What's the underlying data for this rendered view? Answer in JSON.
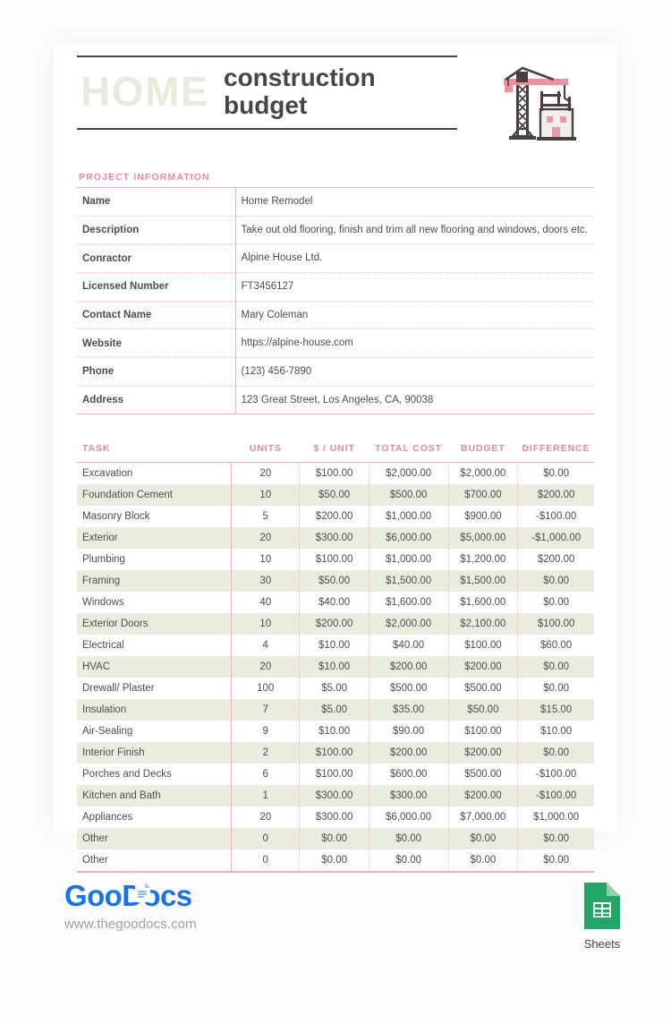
{
  "document": {
    "title_home": "HOME",
    "title_rest_line1": "construction",
    "title_rest_line2": "budget",
    "crane_icon": "construction-crane-icon"
  },
  "project_information": {
    "section_label": "PROJECT INFORMATION",
    "rows": [
      {
        "label": "Name",
        "value": "Home Remodel"
      },
      {
        "label": "Description",
        "value": "Take out old flooring, finish and trim all new flooring and windows, doors etc."
      },
      {
        "label": "Conractor",
        "value": "Alpine House Ltd."
      },
      {
        "label": "Licensed Number",
        "value": "FT3456127"
      },
      {
        "label": "Contact Name",
        "value": "Mary Coleman"
      },
      {
        "label": "Website",
        "value": "https://alpine-house.com"
      },
      {
        "label": "Phone",
        "value": "(123) 456-7890"
      },
      {
        "label": "Address",
        "value": "123 Great Street, Los Angeles, CA, 90038"
      }
    ]
  },
  "budget_table": {
    "headers": [
      "TASK",
      "UNITS",
      "$ / UNIT",
      "TOTAL COST",
      "BUDGET",
      "DIFFERENCE"
    ],
    "rows": [
      {
        "task": "Excavation",
        "units": "20",
        "unit_cost": "$100.00",
        "total_cost": "$2,000.00",
        "budget": "$2,000.00",
        "difference": "$0.00",
        "negative": false
      },
      {
        "task": "Foundation Cement",
        "units": "10",
        "unit_cost": "$50.00",
        "total_cost": "$500.00",
        "budget": "$700.00",
        "difference": "$200.00",
        "negative": false
      },
      {
        "task": "Masonry Block",
        "units": "5",
        "unit_cost": "$200.00",
        "total_cost": "$1,000.00",
        "budget": "$900.00",
        "difference": "-$100.00",
        "negative": true
      },
      {
        "task": "Exterior",
        "units": "20",
        "unit_cost": "$300.00",
        "total_cost": "$6,000.00",
        "budget": "$5,000.00",
        "difference": "-$1,000.00",
        "negative": true
      },
      {
        "task": "Plumbing",
        "units": "10",
        "unit_cost": "$100.00",
        "total_cost": "$1,000.00",
        "budget": "$1,200.00",
        "difference": "$200.00",
        "negative": false
      },
      {
        "task": "Framing",
        "units": "30",
        "unit_cost": "$50.00",
        "total_cost": "$1,500.00",
        "budget": "$1,500.00",
        "difference": "$0.00",
        "negative": false
      },
      {
        "task": "Windows",
        "units": "40",
        "unit_cost": "$40.00",
        "total_cost": "$1,600.00",
        "budget": "$1,600.00",
        "difference": "$0.00",
        "negative": false
      },
      {
        "task": "Exterior Doors",
        "units": "10",
        "unit_cost": "$200.00",
        "total_cost": "$2,000.00",
        "budget": "$2,100.00",
        "difference": "$100.00",
        "negative": false
      },
      {
        "task": "Electrical",
        "units": "4",
        "unit_cost": "$10.00",
        "total_cost": "$40.00",
        "budget": "$100.00",
        "difference": "$60.00",
        "negative": false
      },
      {
        "task": "HVAC",
        "units": "20",
        "unit_cost": "$10.00",
        "total_cost": "$200.00",
        "budget": "$200.00",
        "difference": "$0.00",
        "negative": false
      },
      {
        "task": "Drewall/ Plaster",
        "units": "100",
        "unit_cost": "$5.00",
        "total_cost": "$500.00",
        "budget": "$500.00",
        "difference": "$0.00",
        "negative": false
      },
      {
        "task": "Insulation",
        "units": "7",
        "unit_cost": "$5.00",
        "total_cost": "$35.00",
        "budget": "$50.00",
        "difference": "$15.00",
        "negative": false
      },
      {
        "task": "Air-Sealing",
        "units": "9",
        "unit_cost": "$10.00",
        "total_cost": "$90.00",
        "budget": "$100.00",
        "difference": "$10.00",
        "negative": false
      },
      {
        "task": "Interior Finish",
        "units": "2",
        "unit_cost": "$100.00",
        "total_cost": "$200.00",
        "budget": "$200.00",
        "difference": "$0.00",
        "negative": false
      },
      {
        "task": "Porches and Decks",
        "units": "6",
        "unit_cost": "$100.00",
        "total_cost": "$600.00",
        "budget": "$500.00",
        "difference": "-$100.00",
        "negative": true
      },
      {
        "task": "Kitchen and Bath",
        "units": "1",
        "unit_cost": "$300.00",
        "total_cost": "$300.00",
        "budget": "$200.00",
        "difference": "-$100.00",
        "negative": true
      },
      {
        "task": "Appliances",
        "units": "20",
        "unit_cost": "$300.00",
        "total_cost": "$6,000.00",
        "budget": "$7,000.00",
        "difference": "$1,000.00",
        "negative": false
      },
      {
        "task": "Other",
        "units": "0",
        "unit_cost": "$0.00",
        "total_cost": "$0.00",
        "budget": "$0.00",
        "difference": "$0.00",
        "negative": false
      },
      {
        "task": "Other",
        "units": "0",
        "unit_cost": "$0.00",
        "total_cost": "$0.00",
        "budget": "$0.00",
        "difference": "$0.00",
        "negative": false
      }
    ]
  },
  "footer": {
    "brand_goo": "Goo",
    "brand_docs": "Docs",
    "url": "www.thegoodocs.com",
    "sheets_label": "Sheets",
    "sheets_icon": "google-sheets-icon"
  },
  "colors": {
    "accent_pink": "#e8879b",
    "rule_pink": "#eab3bf",
    "negative_red": "#e8251e",
    "row_alt": "#eaece0",
    "title_dark": "#4a4545",
    "title_ghost": "#e8ecdd",
    "brand_blue": "#1a73e8",
    "sheets_green": "#23a566"
  }
}
